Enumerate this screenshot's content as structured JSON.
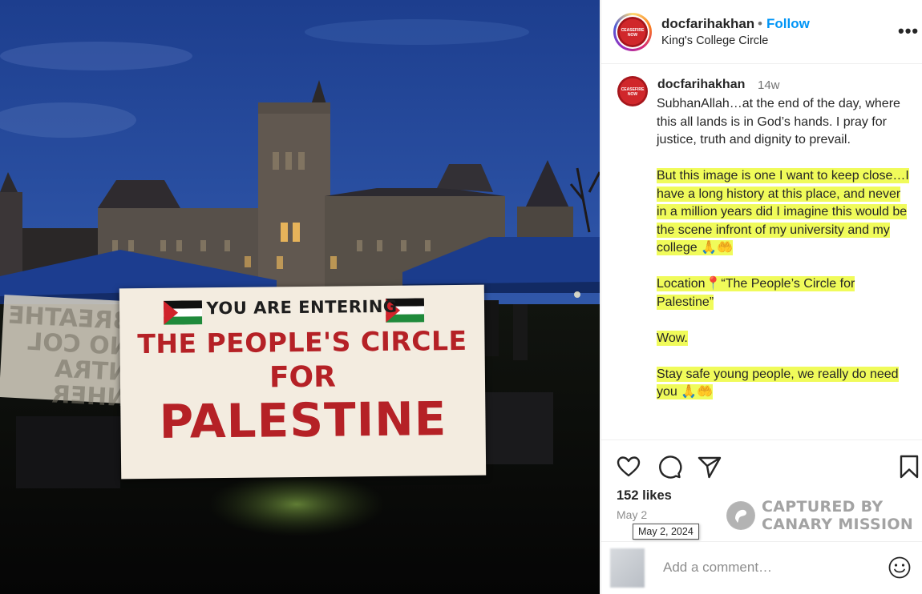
{
  "photo": {
    "banner": {
      "line1": "YOU ARE ENTERING",
      "line2": "THE PEOPLE'S CIRCLE",
      "line3": "FOR",
      "line4": "PALESTINE"
    },
    "left_banner_text": "BREATHE\nNO COL\nNTRA\nNHER"
  },
  "header": {
    "avatar_text": "CEASEFIRE NOW",
    "username": "docfarihakhan",
    "separator": "•",
    "follow_label": "Follow",
    "location": "King's College Circle",
    "more_label": "•••"
  },
  "comment": {
    "avatar_text": "CEASEFIRE NOW",
    "username": "docfarihakhan",
    "time": "14w",
    "paragraphs": [
      "SubhanAllah…at the end of the day, where this all lands is in God’s hands. I pray for justice, truth and dignity to prevail.",
      "But this image is one I want to keep close…I have a long history at this place, and never in a million years did I imagine this would be the scene infront of my university and my college 🙏🤲",
      "Location📍“The People’s Circle for Palestine”",
      "Wow.",
      "Stay safe young people, we really do need you 🙏🤲"
    ]
  },
  "actions": {
    "like_icon": "heart-icon",
    "comment_icon": "comment-icon",
    "share_icon": "paper-plane-icon",
    "save_icon": "bookmark-icon"
  },
  "likes": "152 likes",
  "date": "May 2",
  "date_tooltip": "May 2, 2024",
  "watermark": {
    "line1": "CAPTURED BY",
    "line2": "CANARY MISSION"
  },
  "add_comment": {
    "placeholder": "Add a comment…",
    "emoji_icon": "smiley-icon"
  }
}
